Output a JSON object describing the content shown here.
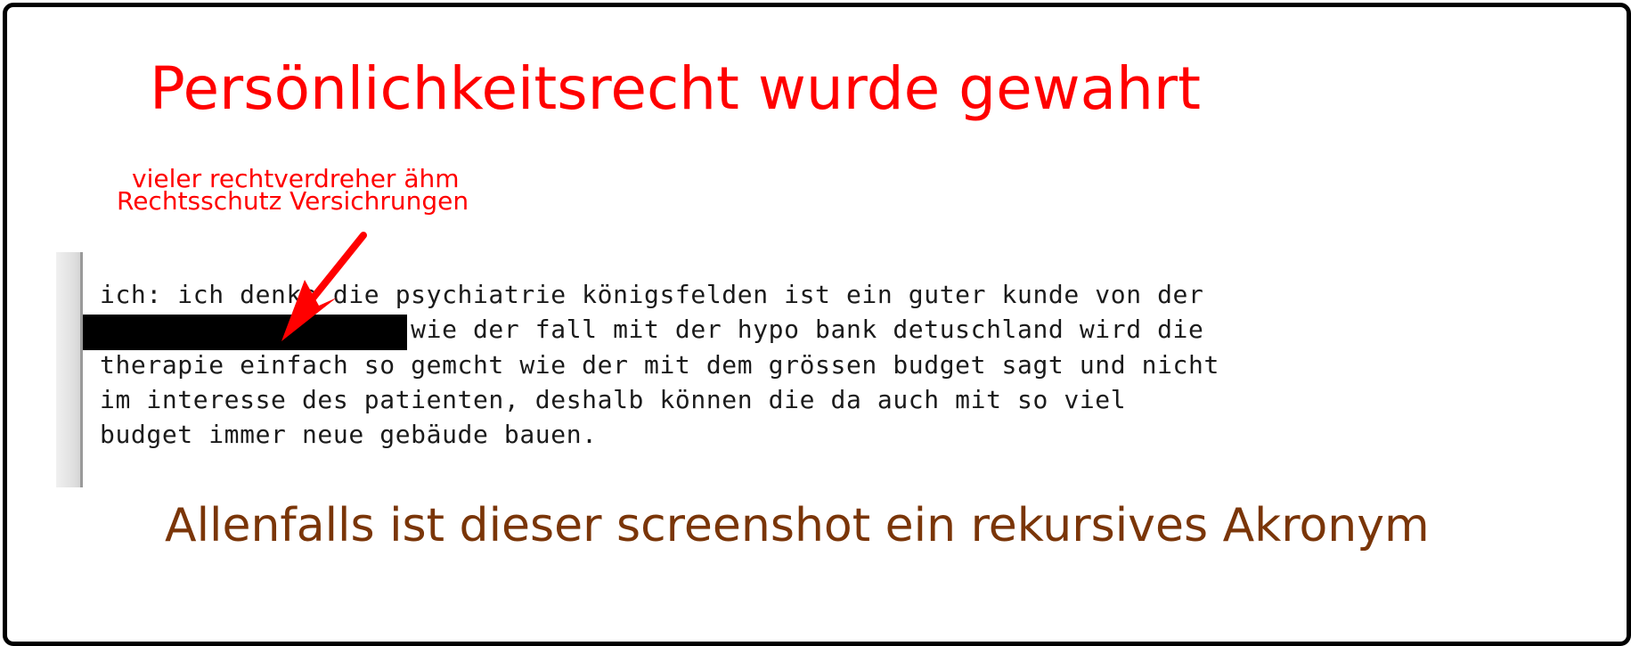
{
  "colors": {
    "title": "#ff0000",
    "note": "#ff0000",
    "arrow": "#ff0000",
    "footer": "#7a3508",
    "redaction": "#000000",
    "frame": "#000000"
  },
  "header": {
    "title": "Persönlichkeitsrecht wurde gewahrt"
  },
  "annotation": {
    "line_1": "vieler rechtverdreher ähm",
    "line_2": "Rechtsschutz Versichrungen",
    "arrow_icon": "red-arrow-icon"
  },
  "quote": {
    "lines": [
      "ich: ich denke die psychiatrie königsfelden ist ein guter kunde von der",
      "                    wie der fall mit der hypo bank detuschland wird die",
      "therapie einfach so gemcht wie der mit dem grössen budget sagt und nicht",
      "im interesse des patienten, deshalb können die da auch mit so viel",
      "budget immer neue gebäude bauen."
    ]
  },
  "footer": {
    "caption": "Allenfalls ist dieser screenshot ein rekursives Akronym"
  }
}
